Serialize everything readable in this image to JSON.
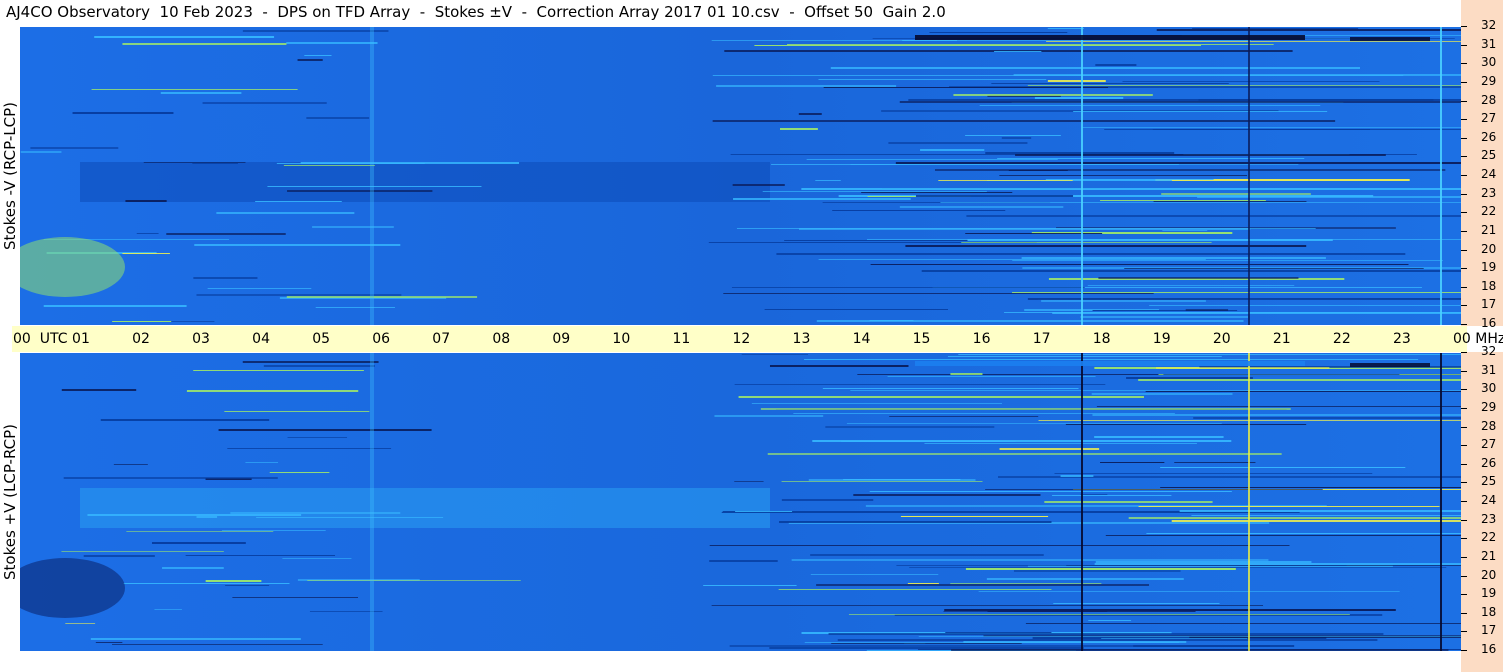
{
  "title": "AJ4CO Observatory  10 Feb 2023  -  DPS on TFD Array  -  Stokes ±V  -  Correction Array 2017 01 10.csv  -  Offset 50  Gain 2.0",
  "panels": {
    "top_label": "Stokes -V (RCP-LCP)",
    "bottom_label": "Stokes +V (LCP-RCP)"
  },
  "time_axis": {
    "labels": [
      "00  UTC",
      "01",
      "02",
      "03",
      "04",
      "05",
      "06",
      "07",
      "08",
      "09",
      "10",
      "11",
      "12",
      "13",
      "14",
      "15",
      "16",
      "17",
      "18",
      "19",
      "20",
      "21",
      "22",
      "23",
      "00 MHz"
    ]
  },
  "freq_axis": {
    "labels": [
      "32",
      "31",
      "30",
      "29",
      "28",
      "27",
      "26",
      "25",
      "24",
      "23",
      "22",
      "21",
      "20",
      "19",
      "18",
      "17",
      "16"
    ]
  },
  "colors": {
    "background_blue": "#1a6fe0",
    "dark_blue": "#0a45b0",
    "cyan": "#3fc0ff",
    "yellow": "#f0f040",
    "timebar": "#ffffc8",
    "freqbar": "#fcdcc4"
  },
  "chart_data": {
    "type": "heatmap",
    "title": "AJ4CO Observatory  10 Feb 2023  -  DPS on TFD Array  -  Stokes ±V  -  Correction Array 2017 01 10.csv  -  Offset 50  Gain 2.0",
    "x": {
      "label": "UTC",
      "range": [
        0,
        24
      ]
    },
    "y": {
      "label": "MHz",
      "range": [
        16,
        32
      ]
    },
    "panels": [
      "Stokes -V (RCP-LCP)",
      "Stokes +V (LCP-RCP)"
    ]
  }
}
